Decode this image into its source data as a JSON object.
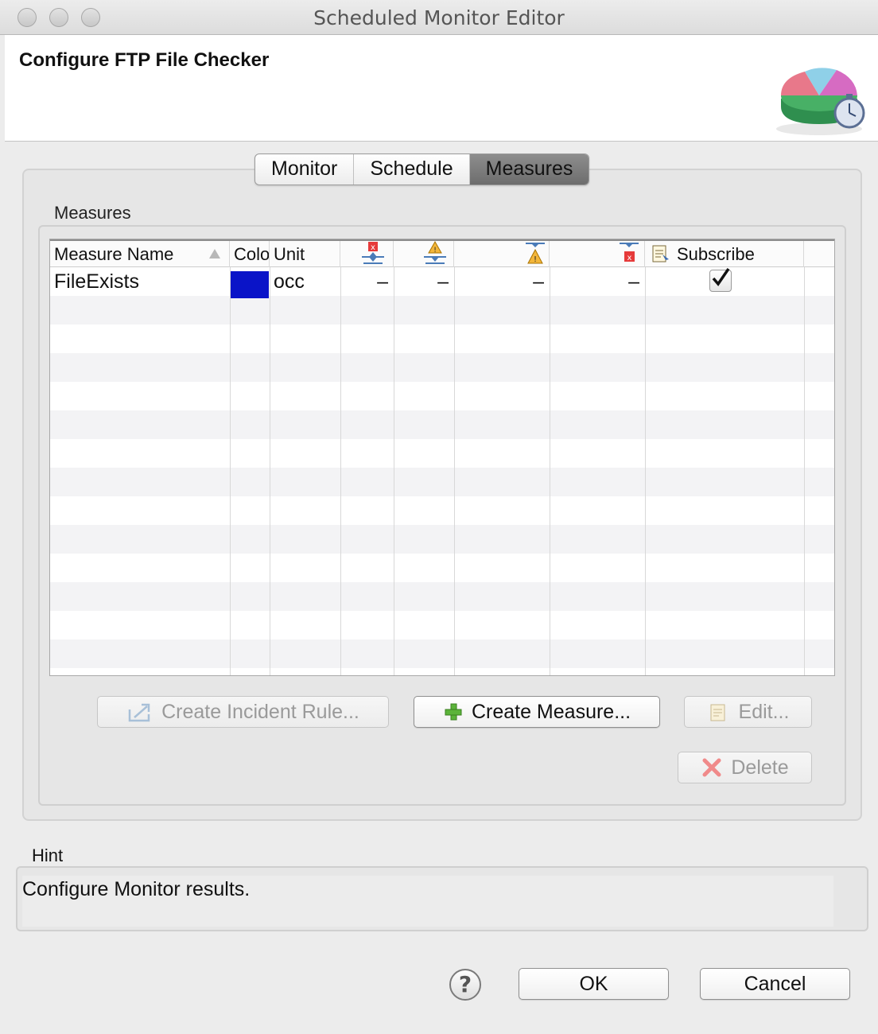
{
  "window": {
    "title": "Scheduled Monitor Editor"
  },
  "header": {
    "title": "Configure FTP File Checker",
    "icon": "pie-chart-stopwatch-icon"
  },
  "tabs": [
    "Monitor",
    "Schedule",
    "Measures"
  ],
  "active_tab": "Measures",
  "measures": {
    "group_label": "Measures",
    "columns": [
      "Measure Name",
      "Colo",
      "Unit",
      "",
      "",
      "",
      "",
      "Subscribe"
    ],
    "column_icons": [
      "sort-ascending-icon",
      "",
      "",
      "upper-severe-threshold-icon",
      "upper-warning-threshold-icon",
      "lower-warning-threshold-icon",
      "lower-severe-threshold-icon",
      "subscribe-icon"
    ],
    "rows": [
      {
        "name": "FileExists",
        "color": "#0a14c8",
        "unit": "occ",
        "t1": "–",
        "t2": "–",
        "t3": "–",
        "t4": "–",
        "subscribed": true
      }
    ]
  },
  "buttons": {
    "create_incident_rule": "Create Incident Rule...",
    "create_measure": "Create Measure...",
    "edit": "Edit...",
    "delete": "Delete",
    "ok": "OK",
    "cancel": "Cancel",
    "help": "?"
  },
  "hint": {
    "label": "Hint",
    "text": "Configure Monitor results."
  }
}
